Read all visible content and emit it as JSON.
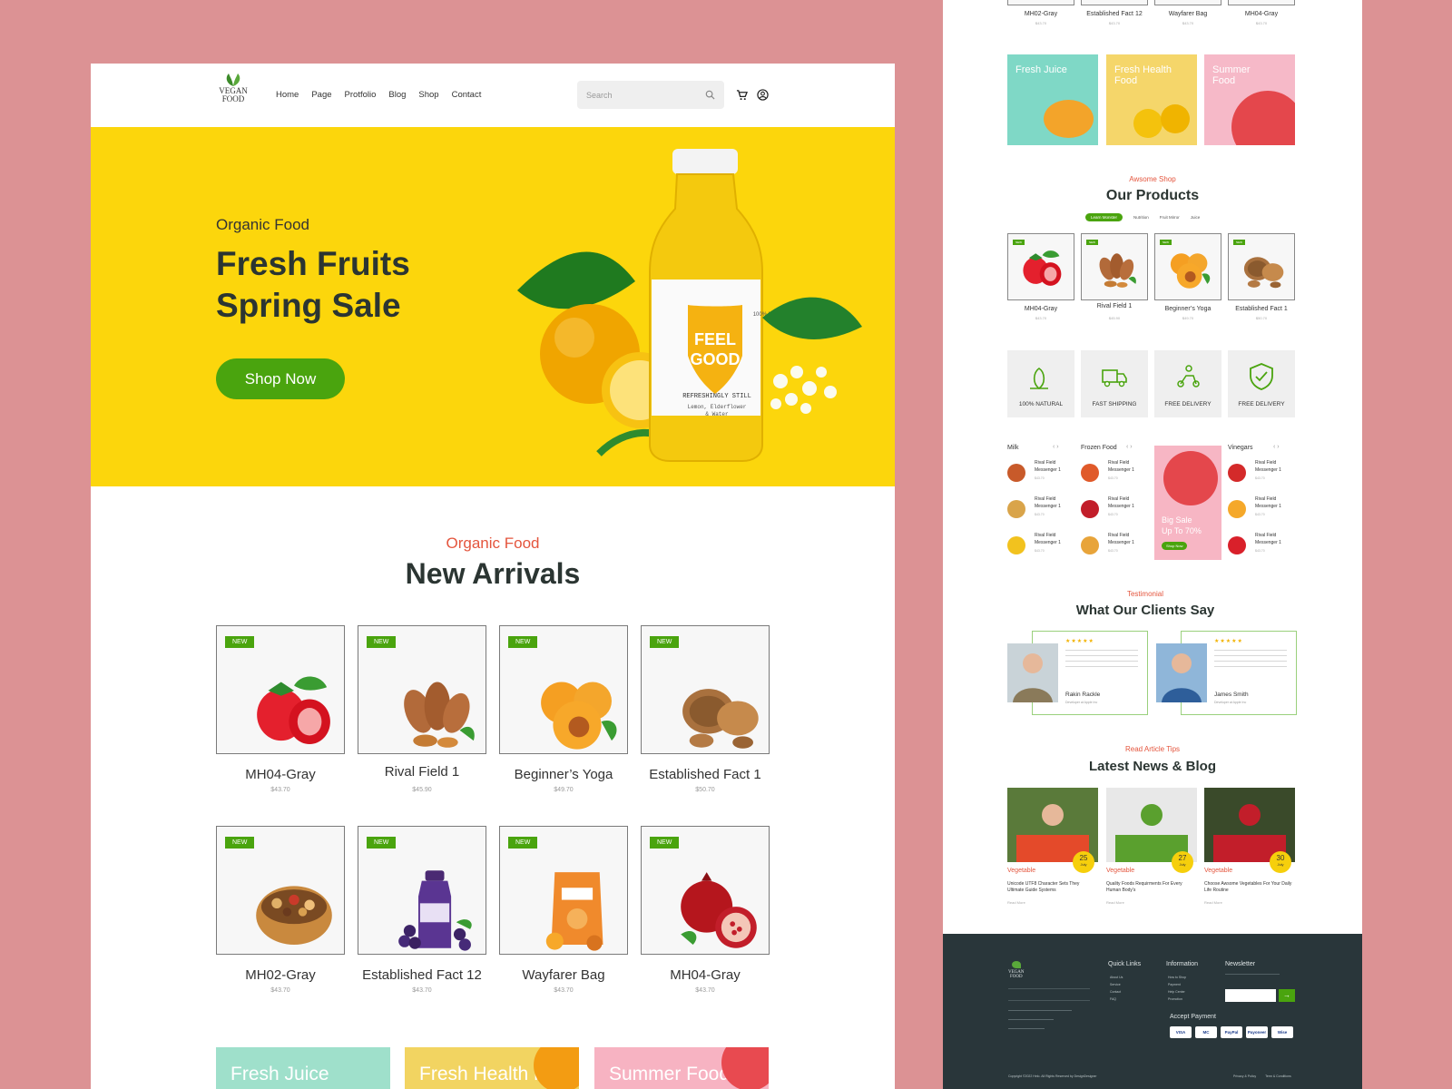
{
  "brand": {
    "logo_text_1": "VEGAN",
    "logo_text_2": "FOOD"
  },
  "nav": {
    "items": [
      "Home",
      "Page",
      "Protfolio",
      "Blog",
      "Shop",
      "Contact"
    ],
    "search_placeholder": "Search"
  },
  "hero": {
    "subtitle": "Organic Food",
    "title": "Fresh Fruits Spring Sale",
    "button": "Shop Now",
    "bottle_brand_1": "FEEL",
    "bottle_brand_2": "GOOD",
    "bottle_tag": "REFRESHINGLY STILL",
    "bottle_desc_1": "Lemon, Elderflower",
    "bottle_desc_2": "& Water",
    "bottle_seal": "100% NATURAL"
  },
  "arrivals": {
    "subtitle": "Organic Food",
    "title": "New Arrivals",
    "badge": "NEW",
    "products": [
      {
        "name": "MH04-Gray",
        "price": "$43.70",
        "icon": "strawberry"
      },
      {
        "name": "Rival Field  1",
        "price": "$45.90",
        "icon": "almond"
      },
      {
        "name": "Beginner’s Yoga",
        "price": "$49.70",
        "icon": "apricot"
      },
      {
        "name": "Established Fact 1",
        "price": "$50.70",
        "icon": "walnut"
      },
      {
        "name": "MH02-Gray",
        "price": "$43.70",
        "icon": "nut-bowl"
      },
      {
        "name": "Established Fact 12",
        "price": "$43.70",
        "icon": "grape-juice"
      },
      {
        "name": "Wayfarer Bag",
        "price": "$43.70",
        "icon": "dried-apricot-bag"
      },
      {
        "name": "MH04-Gray",
        "price": "$43.70",
        "icon": "pomegranate"
      }
    ]
  },
  "promos": [
    {
      "label": "Fresh Juice",
      "color": "#9fe0cb"
    },
    {
      "label": "Fresh Health Food",
      "color": "#f2d461"
    },
    {
      "label": "Summer Food",
      "color": "#f7b3c2"
    }
  ],
  "right": {
    "top_row": [
      {
        "name": "MH02-Gray",
        "price": "$43.70"
      },
      {
        "name": "Established Fact 12",
        "price": "$43.70"
      },
      {
        "name": "Wayfarer Bag",
        "price": "$43.70"
      },
      {
        "name": "MH04-Gray",
        "price": "$43.70"
      }
    ],
    "promos": [
      {
        "label": "Fresh Juice"
      },
      {
        "label": "Fresh Health Food"
      },
      {
        "label": "Summer Food"
      }
    ],
    "shop_sub": "Awsome Shop",
    "shop_title": "Our Products",
    "tabs": [
      "Learn Monster",
      "Nutrition",
      "Fruit Mirror",
      "Juice"
    ],
    "products": [
      {
        "name": "MH04-Gray",
        "price": "$43.70"
      },
      {
        "name": "Rival Field  1",
        "price": "$45.90"
      },
      {
        "name": "Beginner’s Yoga",
        "price": "$49.70"
      },
      {
        "name": "Established Fact 1",
        "price": "$50.70"
      }
    ],
    "features": [
      "100% NATURAL",
      "FAST SHIPPING",
      "FREE DELIVERY",
      "FREE DELIVERY"
    ],
    "lists": [
      {
        "title": "Milk"
      },
      {
        "title": "Frozen Food"
      },
      {
        "title": "Vinegars"
      }
    ],
    "list_item_1": "Rival Field",
    "list_item_2": "Messenger 1",
    "list_price": "$43.70",
    "sale_1": "Big Sale",
    "sale_2": "Up To 70%",
    "sale_btn": "Shop Now",
    "testi_sub": "Testimonial",
    "testi_title": "What Our  Clients Say",
    "testimonials": [
      {
        "name": "Rakin Rackle",
        "role": "Developer at Apple Inc"
      },
      {
        "name": "James Smith",
        "role": "Developer at Apple Inc"
      }
    ],
    "blog_sub": "Read Article Tips",
    "blog_title": "Latest News & Blog",
    "blogs": [
      {
        "cat": "Vegetable",
        "day": "25",
        "month": "July",
        "title": "Unicode UTF8 Character Sets They Ultimate Guide Systems",
        "more": "Read More"
      },
      {
        "cat": "Vegetable",
        "day": "27",
        "month": "July",
        "title": "Quality Foods Requirments For Every Human Body’s",
        "more": "Read More"
      },
      {
        "cat": "Vegetable",
        "day": "30",
        "month": "July",
        "title": "Choose Awsome Vegetables For Your Daily Life Routine",
        "more": "Read More"
      }
    ],
    "footer": {
      "quick": "Quick Links",
      "quick_items": [
        "About Us",
        "Service",
        "Contact",
        "FAQ"
      ],
      "info": "Information",
      "info_items": [
        "How to Shop",
        "Payment",
        "Help Center",
        "Promotion"
      ],
      "news": "Newsletter",
      "pay": "Accept Payment",
      "pay_items": [
        "VISA",
        "MC",
        "PayPal",
        "Payoneer",
        "Wise"
      ],
      "copyright": "Copyright ©2022 Helo. All Rights Reserved by DesignDesigner",
      "links": [
        "Privacy & Policy",
        "Term & Conditions"
      ]
    }
  }
}
